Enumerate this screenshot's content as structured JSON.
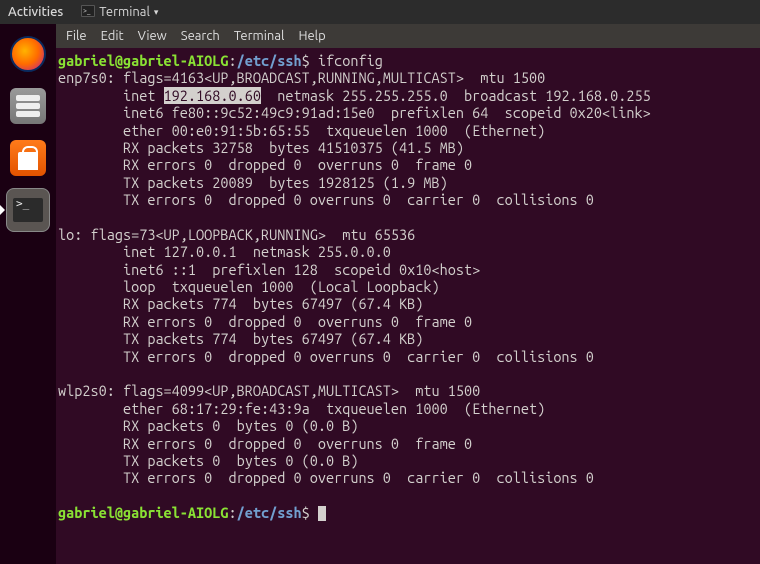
{
  "topbar": {
    "activities": "Activities",
    "app_indicator": "Terminal",
    "dropdown_arrow": "▾"
  },
  "launcher": {
    "items": [
      {
        "name": "firefox-icon",
        "label": "Firefox"
      },
      {
        "name": "files-icon",
        "label": "Files"
      },
      {
        "name": "software-icon",
        "label": "Ubuntu Software"
      },
      {
        "name": "terminal-icon",
        "label": "Terminal"
      }
    ]
  },
  "menubar": {
    "items": [
      "File",
      "Edit",
      "View",
      "Search",
      "Terminal",
      "Help"
    ]
  },
  "terminal": {
    "prompt_user": "gabriel@gabriel-AIOLG",
    "prompt_sep1": ":",
    "prompt_path": "/etc/ssh",
    "prompt_sep2": "$",
    "command": " ifconfig",
    "highlighted_ip": "192.168.0.60",
    "lines": [
      "enp7s0: flags=4163<UP,BROADCAST,RUNNING,MULTICAST>  mtu 1500",
      "        inet ",
      "  netmask 255.255.255.0  broadcast 192.168.0.255",
      "        inet6 fe80::9c52:49c9:91ad:15e0  prefixlen 64  scopeid 0x20<link>",
      "        ether 00:e0:91:5b:65:55  txqueuelen 1000  (Ethernet)",
      "        RX packets 32758  bytes 41510375 (41.5 MB)",
      "        RX errors 0  dropped 0  overruns 0  frame 0",
      "        TX packets 20089  bytes 1928125 (1.9 MB)",
      "        TX errors 0  dropped 0 overruns 0  carrier 0  collisions 0",
      "",
      "lo: flags=73<UP,LOOPBACK,RUNNING>  mtu 65536",
      "        inet 127.0.0.1  netmask 255.0.0.0",
      "        inet6 ::1  prefixlen 128  scopeid 0x10<host>",
      "        loop  txqueuelen 1000  (Local Loopback)",
      "        RX packets 774  bytes 67497 (67.4 KB)",
      "        RX errors 0  dropped 0  overruns 0  frame 0",
      "        TX packets 774  bytes 67497 (67.4 KB)",
      "        TX errors 0  dropped 0 overruns 0  carrier 0  collisions 0",
      "",
      "wlp2s0: flags=4099<UP,BROADCAST,MULTICAST>  mtu 1500",
      "        ether 68:17:29:fe:43:9a  txqueuelen 1000  (Ethernet)",
      "        RX packets 0  bytes 0 (0.0 B)",
      "        RX errors 0  dropped 0  overruns 0  frame 0",
      "        TX packets 0  bytes 0 (0.0 B)",
      "        TX errors 0  dropped 0 overruns 0  carrier 0  collisions 0",
      ""
    ]
  }
}
